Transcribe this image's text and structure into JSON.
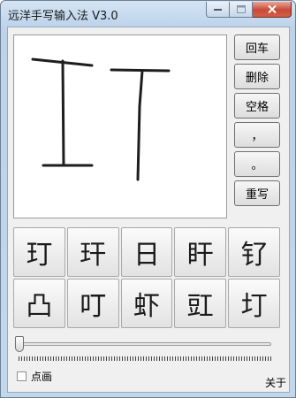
{
  "window": {
    "title": "远洋手写输入法 V3.0"
  },
  "titlebar_buttons": {
    "minimize_icon": "minimize-icon",
    "maximize_icon": "maximize-icon",
    "close_icon": "close-icon"
  },
  "side_buttons": {
    "enter": "回车",
    "delete": "删除",
    "space": "空格",
    "comma": "，",
    "period": "。",
    "rewrite": "重写"
  },
  "candidates": [
    "玎",
    "玕",
    "日",
    "盰",
    "钌",
    "凸",
    "叮",
    "虾",
    "豇",
    "圢"
  ],
  "options": {
    "dot_stroke_label": "点画",
    "dot_stroke_checked": false
  },
  "about_label": "关于",
  "colors": {
    "title_bar": "#c9dcef",
    "close_button": "#c84a35",
    "ink": "#1e1e1e"
  }
}
